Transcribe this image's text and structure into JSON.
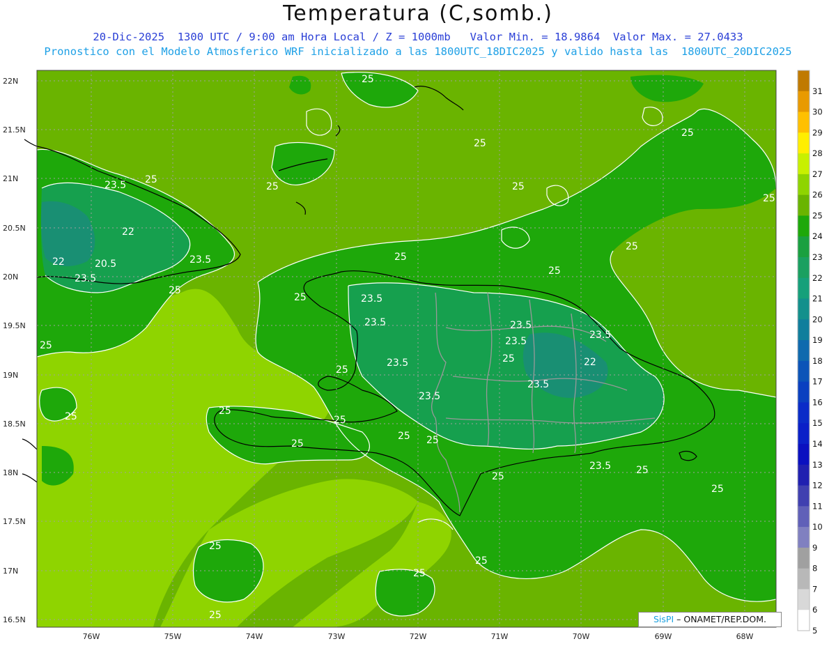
{
  "header": {
    "title": "Temperatura (C,somb.)",
    "line1": "20-Dic-2025  1300 UTC / 9:00 am Hora Local / Z = 1000mb   Valor Min. = 18.9864  Valor Max. = 27.0433",
    "line2": "Pronostico con el Modelo Atmosferico WRF inicializado a las 1800UTC_18DIC2025 y valido hasta las  1800UTC_20DIC2025"
  },
  "axes": {
    "lon_labels": [
      "76W",
      "75W",
      "74W",
      "73W",
      "72W",
      "71W",
      "70W",
      "69W",
      "68W"
    ],
    "lat_labels": [
      "22N",
      "21.5N",
      "21N",
      "20.5N",
      "20N",
      "19.5N",
      "19N",
      "18.5N",
      "18N",
      "17.5N",
      "17N",
      "16.5N"
    ]
  },
  "colorbar": {
    "labels": [
      "31",
      "30",
      "29",
      "28",
      "27",
      "26",
      "25",
      "24",
      "23",
      "22",
      "21",
      "20",
      "19",
      "18",
      "17",
      "16",
      "15",
      "14",
      "13",
      "12",
      "11",
      "10",
      "9",
      "8",
      "7",
      "6",
      "5"
    ],
    "colors": [
      "#c07a00",
      "#e89a00",
      "#ffc000",
      "#ffee00",
      "#c8f000",
      "#8fd400",
      "#6ab400",
      "#1ea80a",
      "#1aa040",
      "#1aa060",
      "#16a07a",
      "#13908c",
      "#107e9c",
      "#0f6aae",
      "#0c54b8",
      "#0a40c0",
      "#0a2cc8",
      "#0a20c8",
      "#0a10c0",
      "#2020b0",
      "#4040b0",
      "#6060b8",
      "#8080c0",
      "#a0a0a0",
      "#b8b8b8",
      "#d8d8d8",
      "#ffffff"
    ]
  },
  "contour_labels": [
    "25",
    "23.5",
    "22",
    "20.5"
  ],
  "map_colors": {
    "sea_warm": "#6ab400",
    "sea_warmer": "#8fd400",
    "land_cool": "#1ea80a",
    "land_cooler": "#16a04e",
    "coolest": "#1a8c7a"
  },
  "credit": {
    "brand": "SisPI",
    "text": " – ONAMET/REP.DOM."
  }
}
